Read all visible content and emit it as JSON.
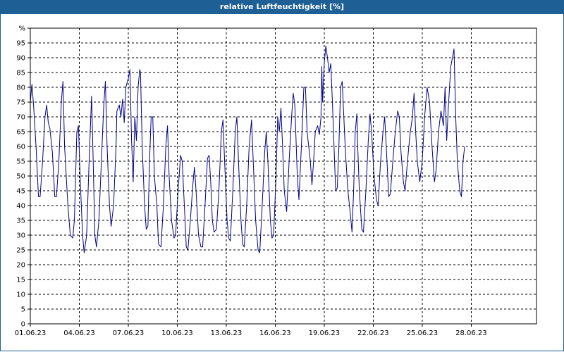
{
  "title": "relative Luftfeuchtigkeit [%]",
  "colors": {
    "title_bar": "#1e5f96",
    "title_text": "#ffffff",
    "line": "#00008b",
    "grid": "#000000",
    "axis": "#000000"
  },
  "chart_data": {
    "type": "line",
    "title": "relative Luftfeuchtigkeit [%]",
    "unit_label": "%",
    "xlabel": "",
    "ylabel": "",
    "x_range_days": [
      0,
      31
    ],
    "ylim": [
      0,
      100
    ],
    "y_ticks": [
      0,
      5,
      10,
      15,
      20,
      25,
      30,
      35,
      40,
      45,
      50,
      55,
      60,
      65,
      70,
      75,
      80,
      85,
      90,
      95
    ],
    "x_ticks": [
      {
        "day": 0,
        "label": "01.06.23"
      },
      {
        "day": 3,
        "label": "04.06.23"
      },
      {
        "day": 6,
        "label": "07.06.23"
      },
      {
        "day": 9,
        "label": "10.06.23"
      },
      {
        "day": 12,
        "label": "13.06.23"
      },
      {
        "day": 15,
        "label": "16.06.23"
      },
      {
        "day": 18,
        "label": "19.06.23"
      },
      {
        "day": 21,
        "label": "22.06.23"
      },
      {
        "day": 24,
        "label": "25.06.23"
      },
      {
        "day": 27,
        "label": "28.06.23"
      }
    ],
    "grid": true,
    "series": [
      {
        "points": [
          [
            0.0,
            75
          ],
          [
            0.1,
            81
          ],
          [
            0.2,
            74
          ],
          [
            0.35,
            60
          ],
          [
            0.5,
            43
          ],
          [
            0.6,
            43
          ],
          [
            0.75,
            55
          ],
          [
            0.9,
            70
          ],
          [
            1.0,
            74
          ],
          [
            1.1,
            68
          ],
          [
            1.2,
            66
          ],
          [
            1.35,
            58
          ],
          [
            1.5,
            43
          ],
          [
            1.6,
            43
          ],
          [
            1.75,
            55
          ],
          [
            1.9,
            75
          ],
          [
            2.0,
            82
          ],
          [
            2.1,
            60
          ],
          [
            2.3,
            40
          ],
          [
            2.45,
            30
          ],
          [
            2.6,
            29
          ],
          [
            2.7,
            35
          ],
          [
            2.85,
            65
          ],
          [
            2.95,
            67
          ],
          [
            3.05,
            50
          ],
          [
            3.2,
            30
          ],
          [
            3.3,
            24
          ],
          [
            3.45,
            30
          ],
          [
            3.6,
            55
          ],
          [
            3.75,
            77
          ],
          [
            3.85,
            55
          ],
          [
            3.95,
            30
          ],
          [
            4.05,
            26
          ],
          [
            4.2,
            35
          ],
          [
            4.35,
            55
          ],
          [
            4.5,
            74
          ],
          [
            4.6,
            82
          ],
          [
            4.7,
            60
          ],
          [
            4.85,
            40
          ],
          [
            4.95,
            33
          ],
          [
            5.1,
            40
          ],
          [
            5.25,
            60
          ],
          [
            5.3,
            72
          ],
          [
            5.45,
            74
          ],
          [
            5.55,
            70
          ],
          [
            5.65,
            76
          ],
          [
            5.75,
            68
          ],
          [
            5.85,
            80
          ],
          [
            6.0,
            83
          ],
          [
            6.1,
            86
          ],
          [
            6.2,
            62
          ],
          [
            6.3,
            48
          ],
          [
            6.4,
            70
          ],
          [
            6.5,
            62
          ],
          [
            6.6,
            80
          ],
          [
            6.7,
            86
          ],
          [
            6.75,
            85
          ],
          [
            6.85,
            60
          ],
          [
            7.0,
            40
          ],
          [
            7.1,
            32
          ],
          [
            7.2,
            33
          ],
          [
            7.3,
            55
          ],
          [
            7.4,
            70
          ],
          [
            7.5,
            70
          ],
          [
            7.6,
            50
          ],
          [
            7.75,
            40
          ],
          [
            7.85,
            27
          ],
          [
            8.0,
            26
          ],
          [
            8.15,
            40
          ],
          [
            8.3,
            60
          ],
          [
            8.4,
            67
          ],
          [
            8.5,
            50
          ],
          [
            8.65,
            35
          ],
          [
            8.8,
            29
          ],
          [
            8.9,
            30
          ],
          [
            9.05,
            45
          ],
          [
            9.2,
            57
          ],
          [
            9.3,
            55
          ],
          [
            9.45,
            38
          ],
          [
            9.55,
            26
          ],
          [
            9.65,
            25
          ],
          [
            9.8,
            35
          ],
          [
            9.95,
            47
          ],
          [
            10.05,
            53
          ],
          [
            10.15,
            45
          ],
          [
            10.3,
            30
          ],
          [
            10.45,
            26
          ],
          [
            10.55,
            26
          ],
          [
            10.7,
            40
          ],
          [
            10.85,
            56
          ],
          [
            10.95,
            57
          ],
          [
            11.05,
            48
          ],
          [
            11.15,
            35
          ],
          [
            11.25,
            31
          ],
          [
            11.4,
            32
          ],
          [
            11.55,
            45
          ],
          [
            11.7,
            65
          ],
          [
            11.8,
            69
          ],
          [
            11.9,
            55
          ],
          [
            12.05,
            35
          ],
          [
            12.15,
            29
          ],
          [
            12.25,
            28
          ],
          [
            12.4,
            45
          ],
          [
            12.55,
            65
          ],
          [
            12.65,
            70
          ],
          [
            12.75,
            55
          ],
          [
            12.9,
            35
          ],
          [
            13.0,
            27
          ],
          [
            13.1,
            26
          ],
          [
            13.25,
            40
          ],
          [
            13.4,
            60
          ],
          [
            13.55,
            69
          ],
          [
            13.65,
            55
          ],
          [
            13.8,
            35
          ],
          [
            13.95,
            25
          ],
          [
            14.05,
            24
          ],
          [
            14.2,
            40
          ],
          [
            14.35,
            58
          ],
          [
            14.45,
            65
          ],
          [
            14.55,
            55
          ],
          [
            14.7,
            35
          ],
          [
            14.8,
            29
          ],
          [
            14.9,
            30
          ],
          [
            15.05,
            50
          ],
          [
            15.15,
            70
          ],
          [
            15.25,
            65
          ],
          [
            15.35,
            73
          ],
          [
            15.45,
            60
          ],
          [
            15.55,
            45
          ],
          [
            15.7,
            38
          ],
          [
            15.85,
            55
          ],
          [
            16.0,
            70
          ],
          [
            16.1,
            78
          ],
          [
            16.2,
            74
          ],
          [
            16.35,
            50
          ],
          [
            16.45,
            42
          ],
          [
            16.6,
            60
          ],
          [
            16.75,
            80
          ],
          [
            16.85,
            80
          ],
          [
            16.95,
            65
          ],
          [
            17.05,
            60
          ],
          [
            17.15,
            55
          ],
          [
            17.25,
            47
          ],
          [
            17.35,
            55
          ],
          [
            17.45,
            65
          ],
          [
            17.6,
            67
          ],
          [
            17.7,
            64
          ],
          [
            17.8,
            70
          ],
          [
            17.85,
            87
          ],
          [
            17.9,
            75
          ],
          [
            18.0,
            88
          ],
          [
            18.1,
            94
          ],
          [
            18.2,
            90
          ],
          [
            18.3,
            85
          ],
          [
            18.4,
            88
          ],
          [
            18.5,
            75
          ],
          [
            18.6,
            60
          ],
          [
            18.7,
            45
          ],
          [
            18.8,
            46
          ],
          [
            18.9,
            60
          ],
          [
            19.0,
            80
          ],
          [
            19.1,
            82
          ],
          [
            19.2,
            70
          ],
          [
            19.3,
            58
          ],
          [
            19.45,
            45
          ],
          [
            19.6,
            37
          ],
          [
            19.7,
            31
          ],
          [
            19.8,
            45
          ],
          [
            19.9,
            65
          ],
          [
            20.0,
            71
          ],
          [
            20.05,
            60
          ],
          [
            20.15,
            45
          ],
          [
            20.3,
            32
          ],
          [
            20.4,
            31
          ],
          [
            20.55,
            45
          ],
          [
            20.7,
            62
          ],
          [
            20.8,
            71
          ],
          [
            20.9,
            65
          ],
          [
            21.05,
            50
          ],
          [
            21.2,
            42
          ],
          [
            21.3,
            40
          ],
          [
            21.45,
            55
          ],
          [
            21.6,
            65
          ],
          [
            21.7,
            70
          ],
          [
            21.8,
            60
          ],
          [
            21.95,
            43
          ],
          [
            22.05,
            44
          ],
          [
            22.2,
            55
          ],
          [
            22.35,
            65
          ],
          [
            22.5,
            72
          ],
          [
            22.6,
            70
          ],
          [
            22.7,
            58
          ],
          [
            22.85,
            48
          ],
          [
            22.95,
            45
          ],
          [
            23.1,
            55
          ],
          [
            23.25,
            64
          ],
          [
            23.4,
            70
          ],
          [
            23.5,
            78
          ],
          [
            23.6,
            65
          ],
          [
            23.7,
            55
          ],
          [
            23.85,
            48
          ],
          [
            24.0,
            55
          ],
          [
            24.15,
            70
          ],
          [
            24.3,
            80
          ],
          [
            24.45,
            75
          ],
          [
            24.6,
            60
          ],
          [
            24.75,
            48
          ],
          [
            24.85,
            52
          ],
          [
            25.0,
            65
          ],
          [
            25.15,
            72
          ],
          [
            25.3,
            67
          ],
          [
            25.4,
            80
          ],
          [
            25.5,
            62
          ],
          [
            25.6,
            73
          ],
          [
            25.75,
            87
          ],
          [
            25.85,
            90
          ],
          [
            25.95,
            93
          ],
          [
            26.05,
            70
          ],
          [
            26.15,
            55
          ],
          [
            26.3,
            45
          ],
          [
            26.4,
            43
          ],
          [
            26.5,
            55
          ],
          [
            26.6,
            60
          ]
        ]
      }
    ]
  }
}
